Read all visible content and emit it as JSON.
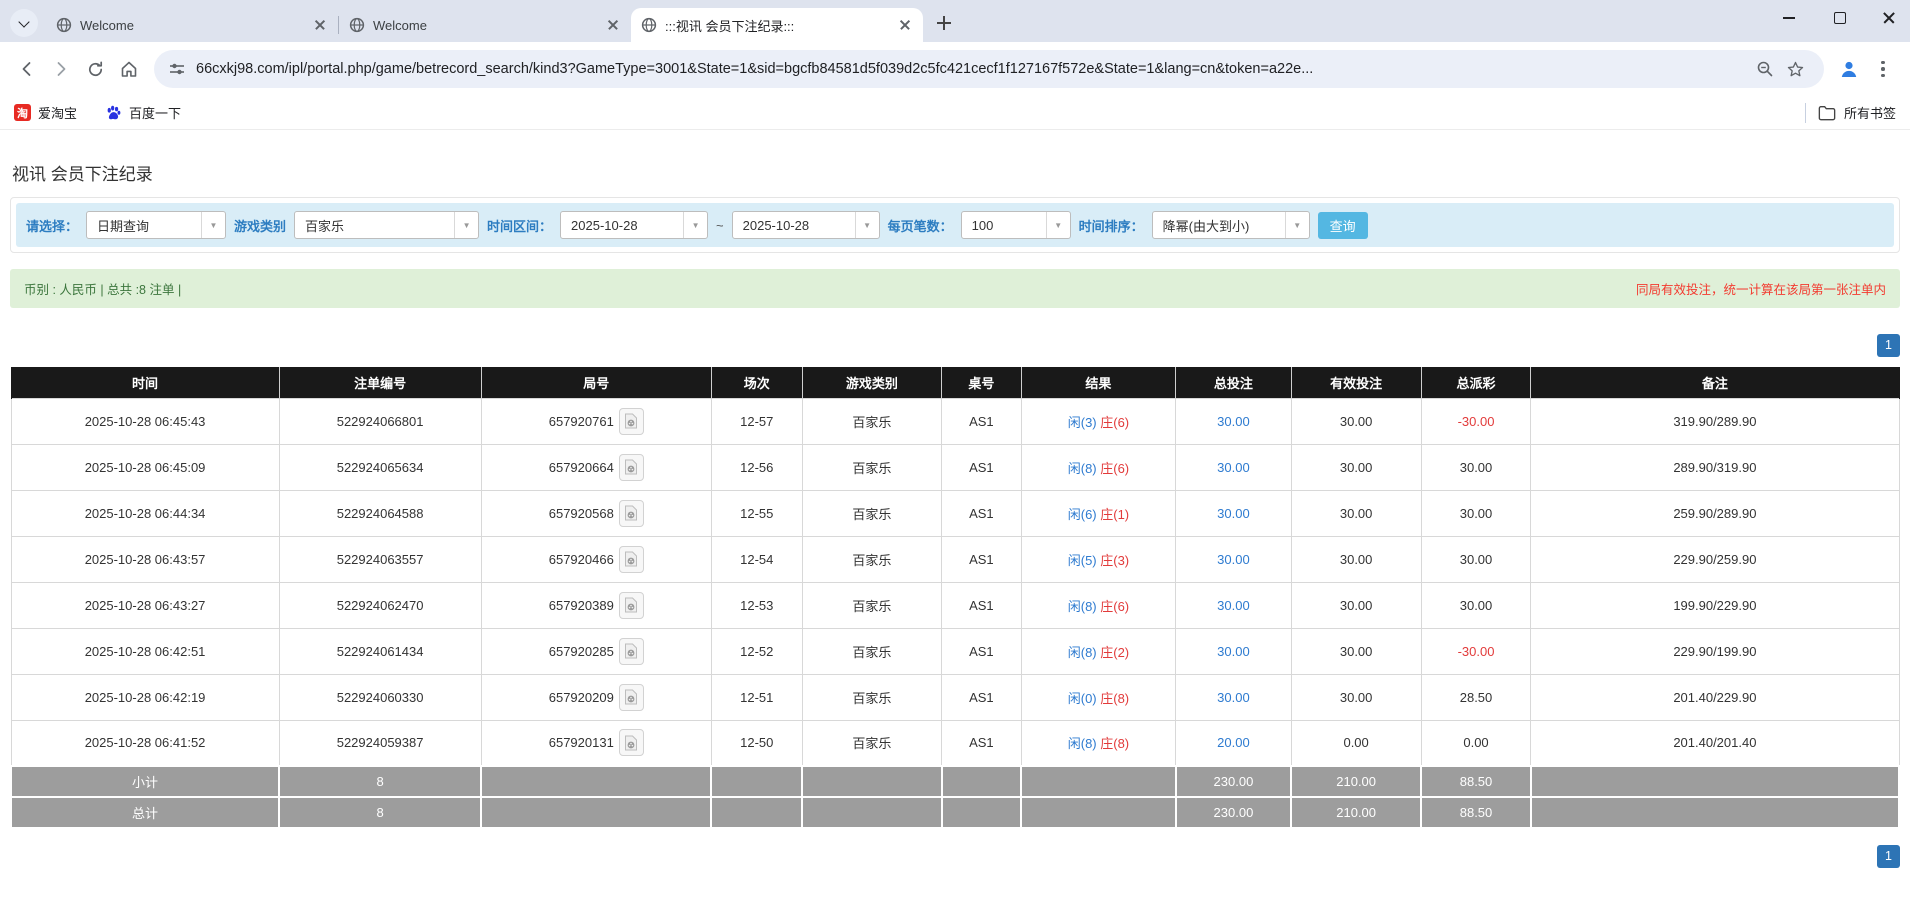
{
  "browser": {
    "tabs": [
      {
        "title": "Welcome"
      },
      {
        "title": "Welcome"
      },
      {
        "title": ":::视讯 会员下注纪录:::"
      }
    ],
    "url": "66cxkj98.com/ipl/portal.php/game/betrecord_search/kind3?GameType=3001&State=1&sid=bgcfb84581d5f039d2c5fc421cecf1f127167f572e&State=1&lang=cn&token=a22e...",
    "bookmarks": [
      {
        "label": "爱淘宝",
        "icon": "taobao-icon",
        "icon_glyph": "淘"
      },
      {
        "label": "百度一下",
        "icon": "baidu-paw-icon"
      }
    ],
    "all_bookmarks_label": "所有书签"
  },
  "page": {
    "title": "视讯 会员下注纪录",
    "filters": {
      "select_label": "请选择：",
      "select_value": "日期查询",
      "game_type_label": "游戏类别",
      "game_type_value": "百家乐",
      "date_range_label": "时间区间：",
      "date_from": "2025-10-28",
      "date_to": "2025-10-28",
      "tilde": "~",
      "page_size_label": "每页笔数：",
      "page_size_value": "100",
      "sort_label": "时间排序：",
      "sort_value": "降幂(由大到小)",
      "search_button": "查询"
    },
    "info_bar": {
      "left": "币别 : 人民币 | 总共 :8 注单 |",
      "right": "同局有效投注，统一计算在该局第一张注单内"
    },
    "pagination": "1",
    "table": {
      "headers": [
        "时间",
        "注单编号",
        "局号",
        "场次",
        "游戏类别",
        "桌号",
        "结果",
        "总投注",
        "有效投注",
        "总派彩",
        "备注"
      ],
      "rows": [
        {
          "time": "2025-10-28 06:45:43",
          "bet_id": "522924066801",
          "round_id": "657920761",
          "session": "12-57",
          "game": "百家乐",
          "table": "AS1",
          "player": "闲(3)",
          "banker": "庄(6)",
          "total_bet": "30.00",
          "valid_bet": "30.00",
          "payout": "-30.00",
          "remark": "319.90/289.90"
        },
        {
          "time": "2025-10-28 06:45:09",
          "bet_id": "522924065634",
          "round_id": "657920664",
          "session": "12-56",
          "game": "百家乐",
          "table": "AS1",
          "player": "闲(8)",
          "banker": "庄(6)",
          "total_bet": "30.00",
          "valid_bet": "30.00",
          "payout": "30.00",
          "remark": "289.90/319.90"
        },
        {
          "time": "2025-10-28 06:44:34",
          "bet_id": "522924064588",
          "round_id": "657920568",
          "session": "12-55",
          "game": "百家乐",
          "table": "AS1",
          "player": "闲(6)",
          "banker": "庄(1)",
          "total_bet": "30.00",
          "valid_bet": "30.00",
          "payout": "30.00",
          "remark": "259.90/289.90"
        },
        {
          "time": "2025-10-28 06:43:57",
          "bet_id": "522924063557",
          "round_id": "657920466",
          "session": "12-54",
          "game": "百家乐",
          "table": "AS1",
          "player": "闲(5)",
          "banker": "庄(3)",
          "total_bet": "30.00",
          "valid_bet": "30.00",
          "payout": "30.00",
          "remark": "229.90/259.90"
        },
        {
          "time": "2025-10-28 06:43:27",
          "bet_id": "522924062470",
          "round_id": "657920389",
          "session": "12-53",
          "game": "百家乐",
          "table": "AS1",
          "player": "闲(8)",
          "banker": "庄(6)",
          "total_bet": "30.00",
          "valid_bet": "30.00",
          "payout": "30.00",
          "remark": "199.90/229.90"
        },
        {
          "time": "2025-10-28 06:42:51",
          "bet_id": "522924061434",
          "round_id": "657920285",
          "session": "12-52",
          "game": "百家乐",
          "table": "AS1",
          "player": "闲(8)",
          "banker": "庄(2)",
          "total_bet": "30.00",
          "valid_bet": "30.00",
          "payout": "-30.00",
          "remark": "229.90/199.90"
        },
        {
          "time": "2025-10-28 06:42:19",
          "bet_id": "522924060330",
          "round_id": "657920209",
          "session": "12-51",
          "game": "百家乐",
          "table": "AS1",
          "player": "闲(0)",
          "banker": "庄(8)",
          "total_bet": "30.00",
          "valid_bet": "30.00",
          "payout": "28.50",
          "remark": "201.40/229.90"
        },
        {
          "time": "2025-10-28 06:41:52",
          "bet_id": "522924059387",
          "round_id": "657920131",
          "session": "12-50",
          "game": "百家乐",
          "table": "AS1",
          "player": "闲(8)",
          "banker": "庄(8)",
          "total_bet": "20.00",
          "valid_bet": "0.00",
          "payout": "0.00",
          "remark": "201.40/201.40"
        }
      ],
      "subtotal": {
        "label": "小计",
        "count": "8",
        "total_bet": "230.00",
        "valid_bet": "210.00",
        "payout": "88.50"
      },
      "total": {
        "label": "总计",
        "count": "8",
        "total_bet": "230.00",
        "valid_bet": "210.00",
        "payout": "88.50"
      }
    },
    "colors": {
      "accent_blue": "#2e7bd0",
      "banker_red": "#e23b3b",
      "header_black": "#191919",
      "footer_grey": "#9d9d9d",
      "notice_green_bg": "#dff0d8",
      "filter_blue_bg": "#d9edf7",
      "pager_blue": "#2d74b5",
      "search_btn_blue": "#54b7e2"
    }
  }
}
